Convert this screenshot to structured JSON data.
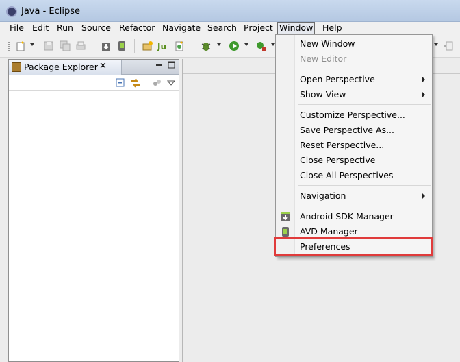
{
  "window": {
    "title": "Java - Eclipse"
  },
  "menubar": [
    {
      "label": "File",
      "mnemonic": "F",
      "rest": "ile"
    },
    {
      "label": "Edit",
      "mnemonic": "E",
      "rest": "dit"
    },
    {
      "label": "Run",
      "mnemonic": "R",
      "rest": "un"
    },
    {
      "label": "Source",
      "mnemonic": "S",
      "rest": "ource"
    },
    {
      "label": "Refactor",
      "pre": "Refac",
      "mnemonic": "t",
      "rest": "or"
    },
    {
      "label": "Navigate",
      "mnemonic": "N",
      "rest": "avigate"
    },
    {
      "label": "Search",
      "pre": "Se",
      "mnemonic": "a",
      "rest": "rch"
    },
    {
      "label": "Project",
      "mnemonic": "P",
      "rest": "roject"
    },
    {
      "label": "Window",
      "mnemonic": "W",
      "rest": "indow"
    },
    {
      "label": "Help",
      "mnemonic": "H",
      "rest": "elp"
    }
  ],
  "view": {
    "tab_label": "Package Explorer",
    "close_glyph": "✕"
  },
  "window_menu": {
    "items": [
      {
        "label": "New Window"
      },
      {
        "label": "New Editor"
      },
      {
        "label": "Open Perspective"
      },
      {
        "label": "Show View"
      },
      {
        "label": "Customize Perspective..."
      },
      {
        "label": "Save Perspective As..."
      },
      {
        "label": "Reset Perspective..."
      },
      {
        "label": "Close Perspective"
      },
      {
        "label": "Close All Perspectives"
      },
      {
        "label": "Navigation"
      },
      {
        "label": "Android SDK Manager"
      },
      {
        "label": "AVD Manager"
      },
      {
        "label": "Preferences"
      }
    ]
  },
  "colors": {
    "highlight": "#e03b3b",
    "menu_bg": "#f5f5f5",
    "title_bar": "#b4c8e2"
  }
}
